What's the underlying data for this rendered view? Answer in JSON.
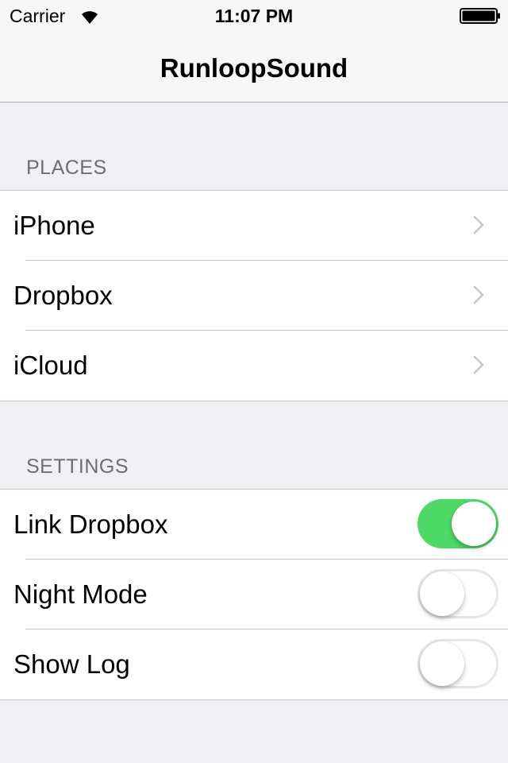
{
  "status_bar": {
    "carrier": "Carrier",
    "time": "11:07 PM",
    "wifi_icon": "wifi-icon",
    "battery_icon": "battery-full-icon"
  },
  "nav": {
    "title": "RunloopSound"
  },
  "places": {
    "header": "PLACES",
    "items": [
      {
        "label": "iPhone",
        "accessory": "chevron-right-icon"
      },
      {
        "label": "Dropbox",
        "accessory": "chevron-right-icon"
      },
      {
        "label": "iCloud",
        "accessory": "chevron-right-icon"
      }
    ]
  },
  "settings": {
    "header": "SETTINGS",
    "items": [
      {
        "label": "Link Dropbox",
        "enabled": true
      },
      {
        "label": "Night Mode",
        "enabled": false
      },
      {
        "label": "Show Log",
        "enabled": false
      }
    ]
  },
  "colors": {
    "toggle_on": "#4cd964",
    "background": "#efeff4",
    "separator": "#c8c7cc",
    "section_header": "#6d6d72",
    "chevron": "#c7c7cc"
  }
}
